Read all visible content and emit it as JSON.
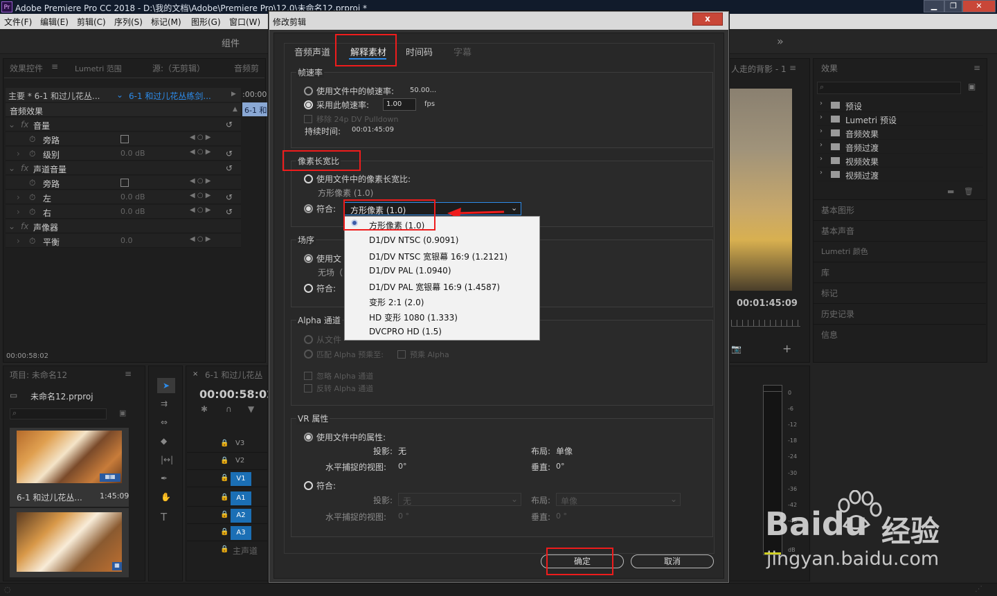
{
  "app": {
    "title": "Adobe Premiere Pro CC 2018 - D:\\我的文档\\Adobe\\Premiere Pro\\12.0\\未命名12.prproj *",
    "logo": "Pr"
  },
  "menu": [
    "文件(F)",
    "编辑(E)",
    "剪辑(C)",
    "序列(S)",
    "标记(M)",
    "图形(G)",
    "窗口(W)"
  ],
  "workspace": {
    "label": "组件",
    "chevron": "»"
  },
  "left_panel": {
    "tabs": [
      "效果控件",
      "Lumetri 范围",
      "源:（无剪辑）",
      "音频剪"
    ],
    "clip_main": "主要 * 6-1  和过儿花丛...",
    "clip_seq": "6-1  和过儿花丛练剑...",
    "timecode_start": ":00:00",
    "mini_clip": "6-1  和",
    "section": "音频效果",
    "rows": [
      {
        "label": "音量",
        "indent": 1,
        "fx": true
      },
      {
        "label": "旁路",
        "indent": 2,
        "checkbox": true
      },
      {
        "label": "级别",
        "indent": 2,
        "value": "0.0 dB"
      },
      {
        "label": "声道音量",
        "indent": 1,
        "fx": true
      },
      {
        "label": "旁路",
        "indent": 2,
        "checkbox": true
      },
      {
        "label": "左",
        "indent": 2,
        "value": "0.0 dB"
      },
      {
        "label": "右",
        "indent": 2,
        "value": "0.0 dB"
      },
      {
        "label": "声像器",
        "indent": 1,
        "fx": true
      },
      {
        "label": "平衡",
        "indent": 2,
        "value": "0.0"
      }
    ],
    "bottom_timecode": "00:00:58:02"
  },
  "project_panel": {
    "title": "项目: 未命名12",
    "file": "未命名12.prproj",
    "clip_name": "6-1  和过儿花丛...",
    "clip_duration": "1:45:09"
  },
  "timeline": {
    "tab": "6-1  和过儿花丛",
    "timecode": "00:00:58:02",
    "tracks": [
      "V3",
      "V2",
      "V1",
      "A1",
      "A2",
      "A3"
    ],
    "master": "主声道"
  },
  "program": {
    "seq_title": "人走的背影 - 1",
    "timecode": "00:01:45:09"
  },
  "effects_panel": {
    "title": "效果",
    "items": [
      "预设",
      "Lumetri 预设",
      "音频效果",
      "音频过渡",
      "视频效果",
      "视频过渡"
    ],
    "sections": [
      "基本图形",
      "基本声音",
      "Lumetri 颜色",
      "库",
      "标记",
      "历史记录",
      "信息"
    ]
  },
  "meter": {
    "labels": [
      "0",
      "-6",
      "-12",
      "-18",
      "-24",
      "-30",
      "-36",
      "-42",
      "-48",
      "dB"
    ]
  },
  "dialog": {
    "title": "修改剪辑",
    "close": "x",
    "tabs": [
      "音频声道",
      "解释素材",
      "时间码",
      "字幕"
    ],
    "active_tab": "解释素材",
    "framerate": {
      "title": "帧速率",
      "use_file": "使用文件中的帧速率:",
      "use_file_value": "50.00...",
      "assume": "采用此帧速率:",
      "assume_value": "1.00",
      "unit": "fps",
      "remove_pulldown": "移除 24p DV Pulldown",
      "duration_label": "持续时间:",
      "duration_value": "00:01:45:09"
    },
    "pixel_aspect": {
      "title": "像素长宽比",
      "use_file": "使用文件中的像素长宽比:",
      "file_value": "方形像素 (1.0)",
      "conform": "符合:",
      "conform_value": "方形像素 (1.0)"
    },
    "dropdown_options": [
      "方形像素 (1.0)",
      "D1/DV NTSC (0.9091)",
      "D1/DV NTSC 宽银幕 16:9 (1.2121)",
      "D1/DV PAL (1.0940)",
      "D1/DV PAL 宽银幕 16:9 (1.4587)",
      "变形 2:1 (2.0)",
      "HD 变形 1080 (1.333)",
      "DVCPRO HD (1.5)"
    ],
    "field_order": {
      "title": "场序",
      "use_file": "使用文",
      "none": "无场（",
      "conform": "符合:"
    },
    "alpha": {
      "title": "Alpha 通道",
      "from_file": "从文件",
      "match_premult": "匹配 Alpha 预乘至:",
      "premult": "预乘 Alpha",
      "ignore": "忽略 Alpha 通道",
      "invert": "反转 Alpha 通道"
    },
    "vr": {
      "title": "VR 属性",
      "use_file": "使用文件中的属性:",
      "projection_label": "投影:",
      "projection_value": "无",
      "layout_label": "布局:",
      "layout_value": "单像",
      "h_view_label": "水平捕捉的视图:",
      "h_view_value": "0°",
      "v_label": "垂直:",
      "v_value": "0°",
      "conform": "符合:",
      "c_projection_value": "无",
      "c_layout_value": "单像",
      "c_h_value": "0 °",
      "c_v_value": "0 °"
    },
    "ok": "确定",
    "cancel": "取消"
  },
  "watermark": {
    "brand": "Baidu",
    "cn": "经验",
    "url": "jingyan.baidu.com"
  }
}
